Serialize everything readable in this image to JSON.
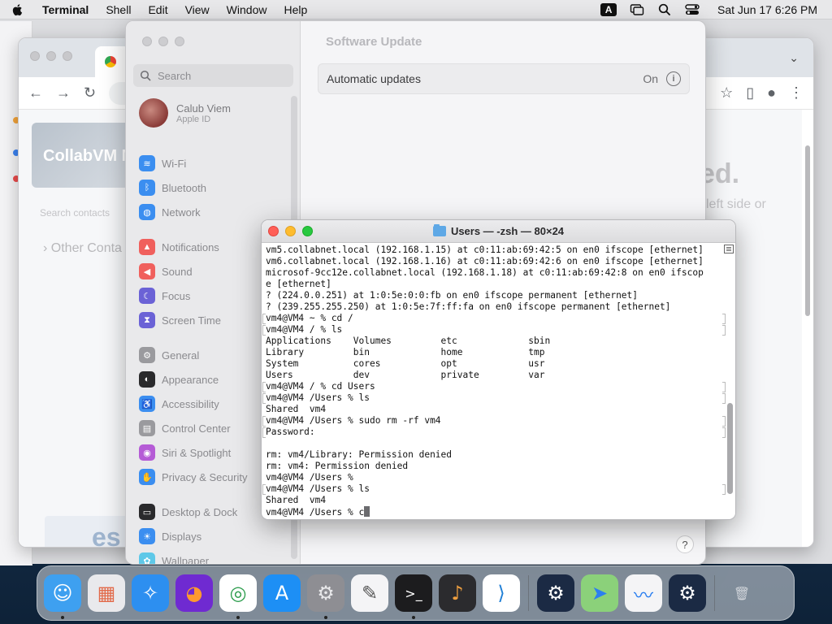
{
  "menubar": {
    "app_name": "Terminal",
    "menus": [
      "Shell",
      "Edit",
      "View",
      "Window",
      "Help"
    ],
    "input_source": "A",
    "clock": "Sat Jun 17  6:26 PM"
  },
  "browser": {
    "page": {
      "card_title": "CollabVM M",
      "search_contacts": "Search contacts",
      "other_contacts": "Other Conta",
      "heading_fragment": "ed.",
      "subtext_fragment": "left side or",
      "logo_text": "es"
    }
  },
  "settings": {
    "search_placeholder": "Search",
    "profile": {
      "name": "Calub Viem",
      "subtitle": "Apple ID"
    },
    "sidebar": [
      {
        "label": "Wi-Fi",
        "icon": "wifi-icon",
        "color": "#3b8ef0",
        "glyph": "≋"
      },
      {
        "label": "Bluetooth",
        "icon": "bluetooth-icon",
        "color": "#3b8ef0",
        "glyph": "ᛒ"
      },
      {
        "label": "Network",
        "icon": "globe-icon",
        "color": "#3b8ef0",
        "glyph": "◍"
      },
      {
        "label": "Notifications",
        "icon": "bell-icon",
        "color": "#f0605d",
        "glyph": "▲"
      },
      {
        "label": "Sound",
        "icon": "speaker-icon",
        "color": "#f0605d",
        "glyph": "◀"
      },
      {
        "label": "Focus",
        "icon": "moon-icon",
        "color": "#6b62d6",
        "glyph": "☾"
      },
      {
        "label": "Screen Time",
        "icon": "hourglass-icon",
        "color": "#6b62d6",
        "glyph": "⧗"
      },
      {
        "label": "General",
        "icon": "gear-icon",
        "color": "#9a9a9e",
        "glyph": "⚙"
      },
      {
        "label": "Appearance",
        "icon": "appearance-icon",
        "color": "#2a2a2c",
        "glyph": "◐"
      },
      {
        "label": "Accessibility",
        "icon": "accessibility-icon",
        "color": "#3b8ef0",
        "glyph": "♿"
      },
      {
        "label": "Control Center",
        "icon": "control-center-icon",
        "color": "#9a9a9e",
        "glyph": "▤"
      },
      {
        "label": "Siri & Spotlight",
        "icon": "siri-icon",
        "color": "#b55bd6",
        "glyph": "◉"
      },
      {
        "label": "Privacy & Security",
        "icon": "hand-icon",
        "color": "#3b8ef0",
        "glyph": "✋"
      },
      {
        "label": "Desktop & Dock",
        "icon": "dock-icon",
        "color": "#2a2a2c",
        "glyph": "▭"
      },
      {
        "label": "Displays",
        "icon": "sun-icon",
        "color": "#3b8ef0",
        "glyph": "☀"
      },
      {
        "label": "Wallpaper",
        "icon": "wallpaper-icon",
        "color": "#5ec8e8",
        "glyph": "✿"
      }
    ],
    "content": {
      "title": "Software Update",
      "auto_updates_label": "Automatic updates",
      "auto_updates_value": "On",
      "help": "?"
    }
  },
  "terminal": {
    "title": "Users — -zsh — 80×24",
    "lines": [
      "vm5.collabnet.local (192.168.1.15) at c0:11:ab:69:42:5 on en0 ifscope [ethernet]",
      "vm6.collabnet.local (192.168.1.16) at c0:11:ab:69:42:6 on en0 ifscope [ethernet]",
      "microsof-9cc12e.collabnet.local (192.168.1.18) at c0:11:ab:69:42:8 on en0 ifscop",
      "e [ethernet]",
      "? (224.0.0.251) at 1:0:5e:0:0:fb on en0 ifscope permanent [ethernet]",
      "? (239.255.255.250) at 1:0:5e:7f:ff:fa on en0 ifscope permanent [ethernet]",
      "vm4@VM4 ~ % cd /",
      "vm4@VM4 / % ls",
      "Applications    Volumes         etc             sbin",
      "Library         bin             home            tmp",
      "System          cores           opt             usr",
      "Users           dev             private         var",
      "vm4@VM4 / % cd Users",
      "vm4@VM4 /Users % ls",
      "Shared  vm4",
      "vm4@VM4 /Users % sudo rm -rf vm4",
      "Password:",
      "",
      "rm: vm4/Library: Permission denied",
      "rm: vm4: Permission denied",
      "vm4@VM4 /Users %",
      "vm4@VM4 /Users % ls",
      "Shared  vm4",
      "vm4@VM4 /Users % c"
    ],
    "marked_lines": [
      6,
      7,
      12,
      13,
      15,
      16,
      21
    ]
  },
  "dock": {
    "apps": [
      {
        "name": "finder-icon",
        "bg": "#3ea0f0",
        "glyph": "☺",
        "fg": "#ffffff",
        "running": true
      },
      {
        "name": "launchpad-icon",
        "bg": "#e9e9ec",
        "glyph": "▦",
        "fg": "#e26a4a",
        "running": false
      },
      {
        "name": "safari-icon",
        "bg": "#2d8ff0",
        "glyph": "✧",
        "fg": "#ffffff",
        "running": false
      },
      {
        "name": "firefox-icon",
        "bg": "#6f2ad1",
        "glyph": "◕",
        "fg": "#ff9a2e",
        "running": false
      },
      {
        "name": "chrome-icon",
        "bg": "#ffffff",
        "glyph": "◎",
        "fg": "#2f9e4f",
        "running": true
      },
      {
        "name": "app-store-icon",
        "bg": "#1d8ff5",
        "glyph": "A",
        "fg": "#ffffff",
        "running": false
      },
      {
        "name": "system-settings-icon",
        "bg": "#8e8e93",
        "glyph": "⚙",
        "fg": "#e8e8ea",
        "running": true
      },
      {
        "name": "textedit-icon",
        "bg": "#f4f4f6",
        "glyph": "✎",
        "fg": "#555555",
        "running": false
      },
      {
        "name": "terminal-icon",
        "bg": "#1c1c1e",
        "glyph": ">_",
        "fg": "#ffffff",
        "running": true
      },
      {
        "name": "garageband-icon",
        "bg": "#2b2b2e",
        "glyph": "♪",
        "fg": "#f0a040",
        "running": false
      },
      {
        "name": "vscode-icon",
        "bg": "#ffffff",
        "glyph": "⟩",
        "fg": "#1f7fd6",
        "running": false
      },
      {
        "name": "steam-icon",
        "bg": "#1b2a44",
        "glyph": "⚙",
        "fg": "#ffffff",
        "running": false
      },
      {
        "name": "maps-icon",
        "bg": "#8bd17a",
        "glyph": "➤",
        "fg": "#2b7ff0",
        "running": false
      },
      {
        "name": "freeform-icon",
        "bg": "#f4f4f6",
        "glyph": "〰",
        "fg": "#2b7ff0",
        "running": false
      },
      {
        "name": "steam-icon-2",
        "bg": "#1b2a44",
        "glyph": "⚙",
        "fg": "#ffffff",
        "running": false
      },
      {
        "name": "trash-icon",
        "bg": "transparent",
        "glyph": "🗑",
        "fg": "#d0d4da",
        "running": false
      }
    ]
  }
}
